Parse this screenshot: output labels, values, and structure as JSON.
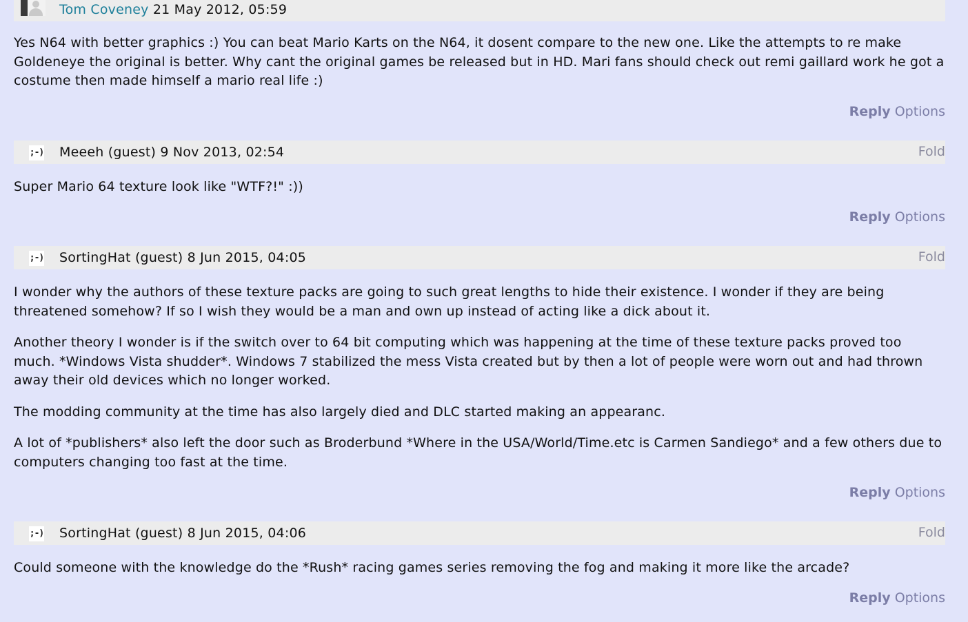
{
  "comments": [
    {
      "author": "Tom Coveney",
      "author_linked": true,
      "date": "21 May 2012, 05:59",
      "fold": "",
      "paragraphs": [
        "Yes N64 with better graphics :) You can beat Mario Karts on the N64, it dosent compare to the new one. Like the attempts to re make Goldeneye the original is better. Why cant the original games be released but in HD. Mari fans should check out remi gaillard work he got a costume then made himself a mario real life :)"
      ],
      "reply": "Reply",
      "options": "Options"
    },
    {
      "author": "Meeeh (guest)",
      "author_linked": false,
      "avatar": ";-)",
      "date": "9 Nov 2013, 02:54",
      "fold": "Fold",
      "paragraphs": [
        "Super Mario 64 texture look like \"WTF?!\" :))"
      ],
      "reply": "Reply",
      "options": "Options"
    },
    {
      "author": "SortingHat (guest)",
      "author_linked": false,
      "avatar": ";-)",
      "date": "8 Jun 2015, 04:05",
      "fold": "Fold",
      "paragraphs": [
        "I wonder why the authors of these texture packs are going to such great lengths to hide their existence. I wonder if they are being threatened somehow? If so I wish they would be a man and own up instead of acting like a dick about it.",
        "Another theory I wonder is if the switch over to 64 bit computing which was happening at the time of these texture packs proved too much. *Windows Vista shudder*. Windows 7 stabilized the mess Vista created but by then a lot of people were worn out and had thrown away their old devices which no longer worked.",
        "The modding community at the time has also largely died and DLC started making an appearanc.",
        "A lot of *publishers* also left the door such as Broderbund *Where in the USA/World/Time.etc is Carmen Sandiego* and a few others due to computers changing too fast at the time."
      ],
      "reply": "Reply",
      "options": "Options"
    },
    {
      "author": "SortingHat (guest)",
      "author_linked": false,
      "avatar": ";-)",
      "date": "8 Jun 2015, 04:06",
      "fold": "Fold",
      "paragraphs": [
        "Could someone with the knowledge do the *Rush* racing games series removing the fog and making it more like the arcade?"
      ],
      "reply": "Reply",
      "options": "Options"
    }
  ]
}
